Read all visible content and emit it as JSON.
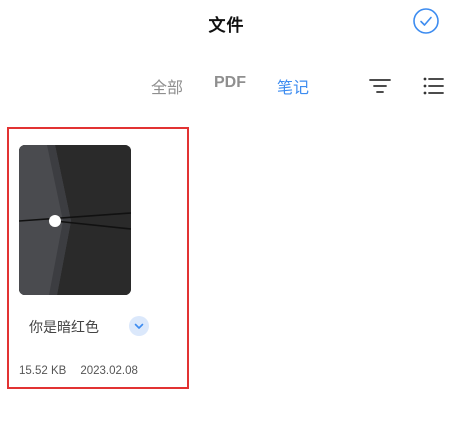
{
  "header": {
    "title": "文件"
  },
  "tabs": [
    {
      "label": "全部",
      "active": false
    },
    {
      "label": "PDF",
      "active": false
    },
    {
      "label": "笔记",
      "active": true
    }
  ],
  "toolbar": {
    "sort_icon": "sort-filter-icon",
    "list_icon": "list-view-icon",
    "confirm_icon": "check-circle-icon"
  },
  "files": [
    {
      "name": "你是暗红色",
      "size": "15.52 KB",
      "date": "2023.02.08",
      "selected": true
    }
  ],
  "colors": {
    "accent": "#3d8cf0",
    "tab_inactive": "#8f8f8f",
    "selection_border": "#e23232",
    "thumb_bg": "#2b2b2b"
  }
}
